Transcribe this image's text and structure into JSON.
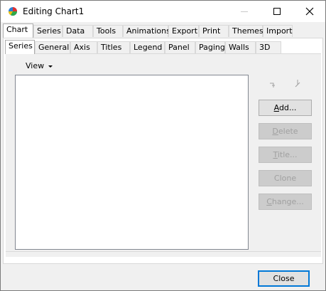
{
  "window": {
    "title": "Editing Chart1"
  },
  "top_tabs": [
    {
      "label": "Chart",
      "active": true
    },
    {
      "label": "Series"
    },
    {
      "label": "Data"
    },
    {
      "label": "Tools"
    },
    {
      "label": "Animations"
    },
    {
      "label": "Export"
    },
    {
      "label": "Print"
    },
    {
      "label": "Themes"
    },
    {
      "label": "Import"
    }
  ],
  "sub_tabs": [
    {
      "label": "Series",
      "active": true
    },
    {
      "label": "General"
    },
    {
      "label": "Axis"
    },
    {
      "label": "Titles"
    },
    {
      "label": "Legend"
    },
    {
      "label": "Panel"
    },
    {
      "label": "Paging"
    },
    {
      "label": "Walls"
    },
    {
      "label": "3D"
    }
  ],
  "series_panel": {
    "view_label": "View",
    "buttons": {
      "add": {
        "mnemonic": "A",
        "rest": "dd...",
        "enabled": true
      },
      "delete": {
        "mnemonic": "D",
        "rest": "elete",
        "enabled": false
      },
      "title": {
        "mnemonic": "T",
        "rest": "itle...",
        "enabled": false
      },
      "clone": {
        "label": "Clone",
        "enabled": false
      },
      "change": {
        "mnemonic": "C",
        "rest": "hange...",
        "enabled": false
      }
    }
  },
  "footer": {
    "close_label": "Close"
  },
  "colors": {
    "focus_border": "#0078d7",
    "disabled_text": "#a0a0a0"
  }
}
